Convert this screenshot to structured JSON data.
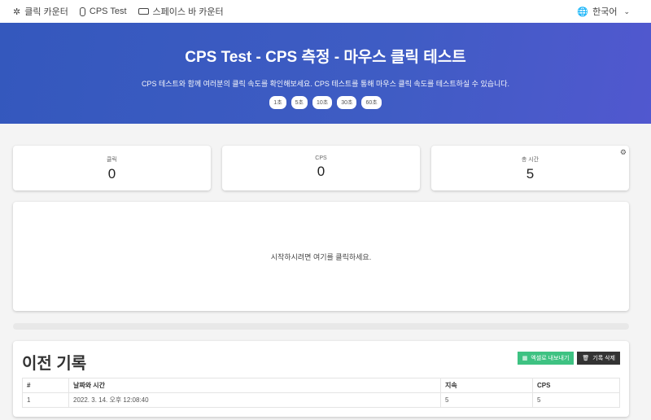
{
  "nav": {
    "items": [
      {
        "label": "클릭 카운터",
        "icon": "sparkle-icon"
      },
      {
        "label": "CPS Test",
        "icon": "mouse-icon"
      },
      {
        "label": "스페이스 바 카운터",
        "icon": "keyboard-icon"
      }
    ],
    "language": "한국어"
  },
  "hero": {
    "title": "CPS Test - CPS 측정 - 마우스 클릭 테스트",
    "subtitle": "CPS 테스트와 함께 여러분의 클릭 속도를 확인해보세요. CPS 테스트를 통해 마우스 클릭 속도를 테스트하실 수 있습니다.",
    "durations": [
      "1초",
      "5초",
      "10초",
      "30초",
      "60초"
    ]
  },
  "stats": [
    {
      "label": "클릭",
      "value": "0"
    },
    {
      "label": "CPS",
      "value": "0"
    },
    {
      "label": "총 시간",
      "value": "5"
    }
  ],
  "click_area": {
    "prompt": "시작하시려면 여기를 클릭하세요."
  },
  "progress": 0,
  "history": {
    "title": "이전 기록",
    "export_label": "엑셀로 내보내기",
    "delete_label": "기록 삭제",
    "columns": [
      "#",
      "날짜와 시간",
      "지속",
      "CPS"
    ],
    "rows": [
      [
        "1",
        "2022. 3. 14. 오후 12:08:40",
        "5",
        "5"
      ]
    ]
  },
  "colors": {
    "accent": "#3f5cc4",
    "export": "#3ec282",
    "delete": "#333333"
  }
}
